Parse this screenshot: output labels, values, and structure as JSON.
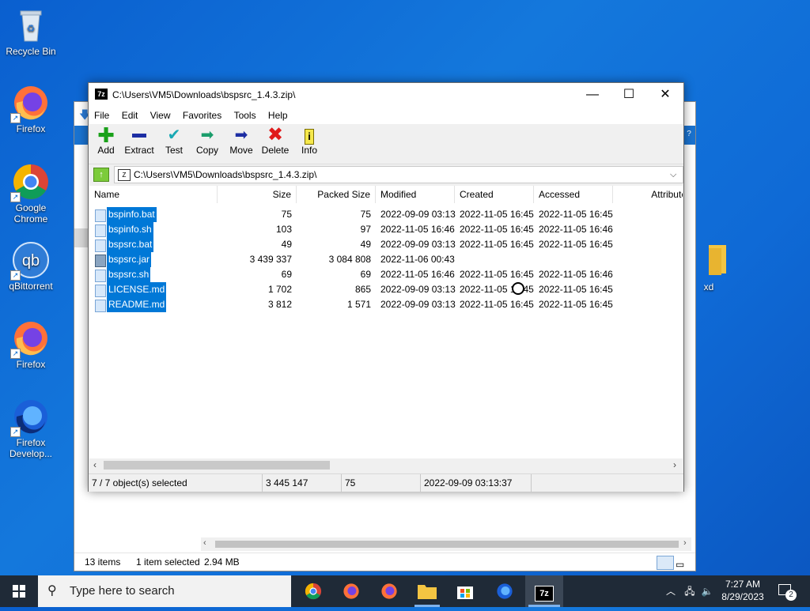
{
  "desktop": {
    "icons": [
      {
        "label": "Recycle Bin"
      },
      {
        "label": "Firefox"
      },
      {
        "label": "Google Chrome"
      },
      {
        "label": "qBittorrent"
      },
      {
        "label": "Firefox"
      },
      {
        "label": "Firefox Develop..."
      },
      {
        "label": "xd"
      }
    ]
  },
  "explorer": {
    "status_items": "13 items",
    "status_selected": "1 item selected",
    "status_size": "2.94 MB"
  },
  "zip": {
    "title": "C:\\Users\\VM5\\Downloads\\bspsrc_1.4.3.zip\\",
    "app_icon": "7z",
    "menu": [
      "File",
      "Edit",
      "View",
      "Favorites",
      "Tools",
      "Help"
    ],
    "toolbar": [
      "Add",
      "Extract",
      "Test",
      "Copy",
      "Move",
      "Delete",
      "Info"
    ],
    "address": "C:\\Users\\VM5\\Downloads\\bspsrc_1.4.3.zip\\",
    "columns": [
      "Name",
      "Size",
      "Packed Size",
      "Modified",
      "Created",
      "Accessed",
      "Attribute"
    ],
    "rows": [
      {
        "name": "bspinfo.bat",
        "size": "75",
        "packed": "75",
        "modified": "2022-09-09 03:13",
        "created": "2022-11-05 16:45",
        "accessed": "2022-11-05 16:45"
      },
      {
        "name": "bspinfo.sh",
        "size": "103",
        "packed": "97",
        "modified": "2022-11-05 16:46",
        "created": "2022-11-05 16:45",
        "accessed": "2022-11-05 16:46"
      },
      {
        "name": "bspsrc.bat",
        "size": "49",
        "packed": "49",
        "modified": "2022-09-09 03:13",
        "created": "2022-11-05 16:45",
        "accessed": "2022-11-05 16:45"
      },
      {
        "name": "bspsrc.jar",
        "size": "3 439 337",
        "packed": "3 084 808",
        "modified": "2022-11-06 00:43",
        "created": "",
        "accessed": ""
      },
      {
        "name": "bspsrc.sh",
        "size": "69",
        "packed": "69",
        "modified": "2022-11-05 16:46",
        "created": "2022-11-05 16:45",
        "accessed": "2022-11-05 16:46"
      },
      {
        "name": "LICENSE.md",
        "size": "1 702",
        "packed": "865",
        "modified": "2022-09-09 03:13",
        "created": "2022-11-05 16:45",
        "accessed": "2022-11-05 16:45"
      },
      {
        "name": "README.md",
        "size": "3 812",
        "packed": "1 571",
        "modified": "2022-09-09 03:13",
        "created": "2022-11-05 16:45",
        "accessed": "2022-11-05 16:45"
      }
    ],
    "status": {
      "selected": "7 / 7 object(s) selected",
      "total_size": "3 445 147",
      "item_size": "75",
      "modified": "2022-09-09 03:13:37"
    }
  },
  "taskbar": {
    "search_placeholder": "Type here to search",
    "time": "7:27 AM",
    "date": "8/29/2023",
    "notifications": "2",
    "zip_label": "7z"
  }
}
